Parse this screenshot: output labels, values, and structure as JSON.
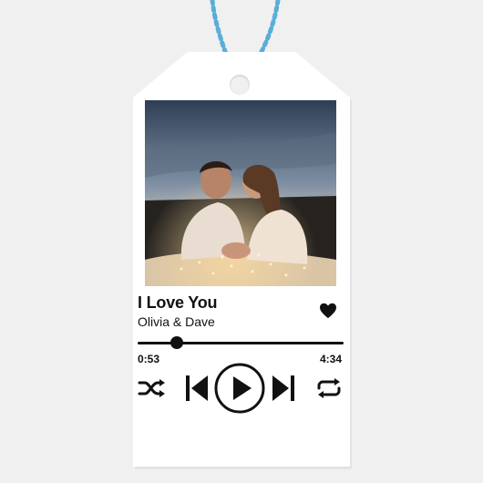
{
  "track": {
    "title": "I Love You",
    "artist": "Olivia & Dave"
  },
  "player": {
    "elapsed": "0:53",
    "total": "4:34",
    "progress": 0.19,
    "liked": true
  },
  "icons": {
    "like": "heart-icon",
    "shuffle": "shuffle-icon",
    "previous": "skip-previous-icon",
    "play": "play-icon",
    "next": "skip-next-icon",
    "repeat": "repeat-icon"
  },
  "colors": {
    "ink": "#111111",
    "card": "#ffffff",
    "background": "#f0f0f0",
    "twine_blue": "#5aaed6"
  }
}
